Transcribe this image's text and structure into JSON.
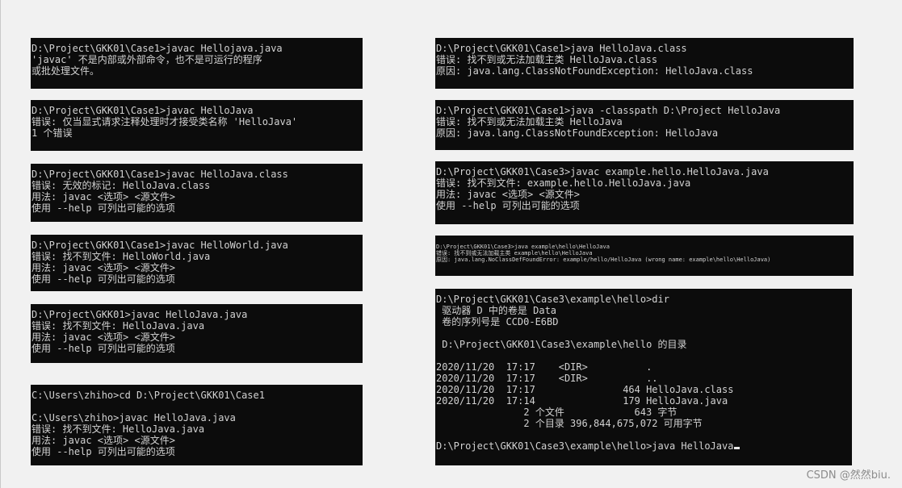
{
  "terminals": [
    {
      "lines": [
        "D:\\Project\\GKK01\\Case1>javac Hellojava.java",
        "'javac' 不是内部或外部命令，也不是可运行的程序",
        "或批处理文件。"
      ]
    },
    {
      "lines": [
        "D:\\Project\\GKK01\\Case1>javac HelloJava",
        "错误: 仅当显式请求注释处理时才接受类名称 'HelloJava'",
        "1 个错误"
      ]
    },
    {
      "lines": [
        "D:\\Project\\GKK01\\Case1>javac HelloJava.class",
        "错误: 无效的标记: HelloJava.class",
        "用法: javac <选项> <源文件>",
        "使用 --help 可列出可能的选项"
      ]
    },
    {
      "lines": [
        "D:\\Project\\GKK01\\Case1>javac HelloWorld.java",
        "错误: 找不到文件: HelloWorld.java",
        "用法: javac <选项> <源文件>",
        "使用 --help 可列出可能的选项"
      ]
    },
    {
      "lines": [
        "D:\\Project\\GKK01>javac HelloJava.java",
        "错误: 找不到文件: HelloJava.java",
        "用法: javac <选项> <源文件>",
        "使用 --help 可列出可能的选项"
      ]
    },
    {
      "lines": [
        "C:\\Users\\zhiho>cd D:\\Project\\GKK01\\Case1",
        "",
        "C:\\Users\\zhiho>javac HelloJava.java",
        "错误: 找不到文件: HelloJava.java",
        "用法: javac <选项> <源文件>",
        "使用 --help 可列出可能的选项"
      ]
    },
    {
      "lines": [
        "D:\\Project\\GKK01\\Case1>java HelloJava.class",
        "错误: 找不到或无法加载主类 HelloJava.class",
        "原因: java.lang.ClassNotFoundException: HelloJava.class"
      ]
    },
    {
      "lines": [
        "D:\\Project\\GKK01\\Case1>java -classpath D:\\Project HelloJava",
        "错误: 找不到或无法加载主类 HelloJava",
        "原因: java.lang.ClassNotFoundException: HelloJava"
      ]
    },
    {
      "lines": [
        "D:\\Project\\GKK01\\Case3>javac example.hello.HelloJava.java",
        "错误: 找不到文件: example.hello.HelloJava.java",
        "用法: javac <选项> <源文件>",
        "使用 --help 可列出可能的选项"
      ]
    },
    {
      "lines": [
        "D:\\Project\\GKK01\\Case3>java example\\hello\\HelloJava",
        "错误: 找不到或无法加载主类 example\\hello\\HelloJava",
        "原因: java.lang.NoClassDefFoundError: example/hello/HelloJava (wrong name: example\\hello\\HelloJava)"
      ]
    },
    {
      "lines": [
        "D:\\Project\\GKK01\\Case3\\example\\hello>dir",
        " 驱动器 D 中的卷是 Data",
        " 卷的序列号是 CCD0-E6BD",
        "",
        " D:\\Project\\GKK01\\Case3\\example\\hello 的目录",
        "",
        "2020/11/20  17:17    <DIR>          .",
        "2020/11/20  17:17    <DIR>          ..",
        "2020/11/20  17:17               464 HelloJava.class",
        "2020/11/20  17:14               179 HelloJava.java",
        "               2 个文件            643 字节",
        "               2 个目录 396,844,675,072 可用字节",
        "",
        "D:\\Project\\GKK01\\Case3\\example\\hello>java HelloJava"
      ]
    }
  ],
  "watermark": "CSDN @然然biu."
}
